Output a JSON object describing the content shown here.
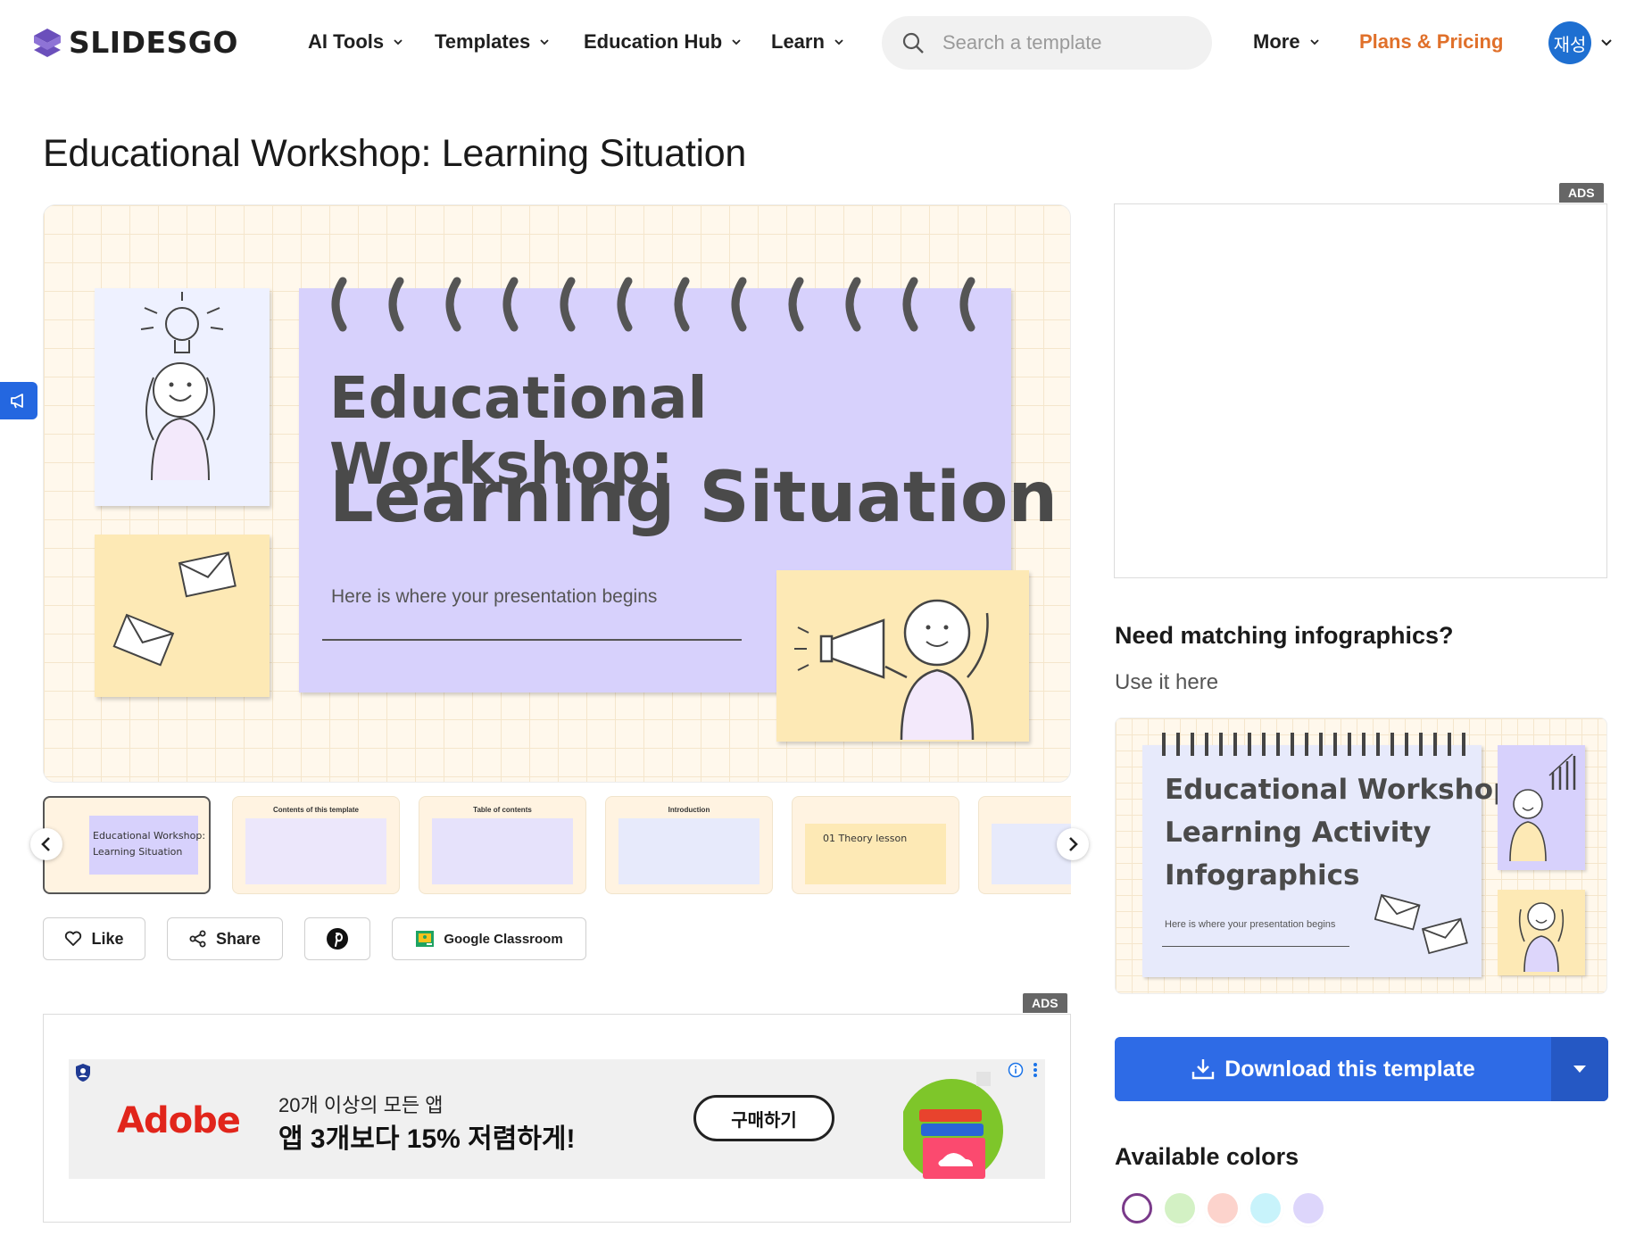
{
  "brand": {
    "name": "SLIDESGO"
  },
  "nav": {
    "items": [
      {
        "label": "AI Tools"
      },
      {
        "label": "Templates"
      },
      {
        "label": "Education Hub"
      },
      {
        "label": "Learn"
      }
    ],
    "search_placeholder": "Search a template",
    "more_label": "More",
    "plans_label": "Plans & Pricing",
    "avatar_text": "재성"
  },
  "page_title": "Educational Workshop: Learning Situation",
  "preview": {
    "title_line1": "Educational Workshop:",
    "title_line2": "Learning Situation",
    "subtitle": "Here is where your presentation begins"
  },
  "thumbnails": [
    {
      "label": "",
      "text_line1": "Educational Workshop:",
      "text_line2": "Learning Situation",
      "active": true
    },
    {
      "label": "Contents of this template"
    },
    {
      "label": "Table of contents"
    },
    {
      "label": "Introduction"
    },
    {
      "label": "",
      "text_line1": "01  Theory lesson"
    },
    {
      "label": ""
    }
  ],
  "actions": {
    "like_label": "Like",
    "share_label": "Share",
    "classroom_label": "Google Classroom"
  },
  "ads": {
    "label": "ADS",
    "adobe": {
      "logo": "Adobe",
      "line1": "20개 이상의 모든 앱",
      "line2": "앱 3개보다 15% 저렴하게!",
      "cta": "구매하기"
    }
  },
  "sidebar": {
    "infographics_heading": "Need matching infographics?",
    "infographics_sub": "Use it here",
    "card": {
      "line1": "Educational Workshop:",
      "line2": "Learning Activity",
      "line3": "Infographics",
      "subtitle": "Here is where your presentation begins"
    },
    "download_label": "Download this template",
    "colors_heading": "Available colors",
    "colors": [
      "#ffffff",
      "#d3f1c4",
      "#fcd3cc",
      "#c8f3fb",
      "#ddd6fb"
    ],
    "selected_color_ring": "#7a3a8a"
  },
  "accent": {
    "primary": "#2e6be6",
    "plans": "#e0702a"
  }
}
